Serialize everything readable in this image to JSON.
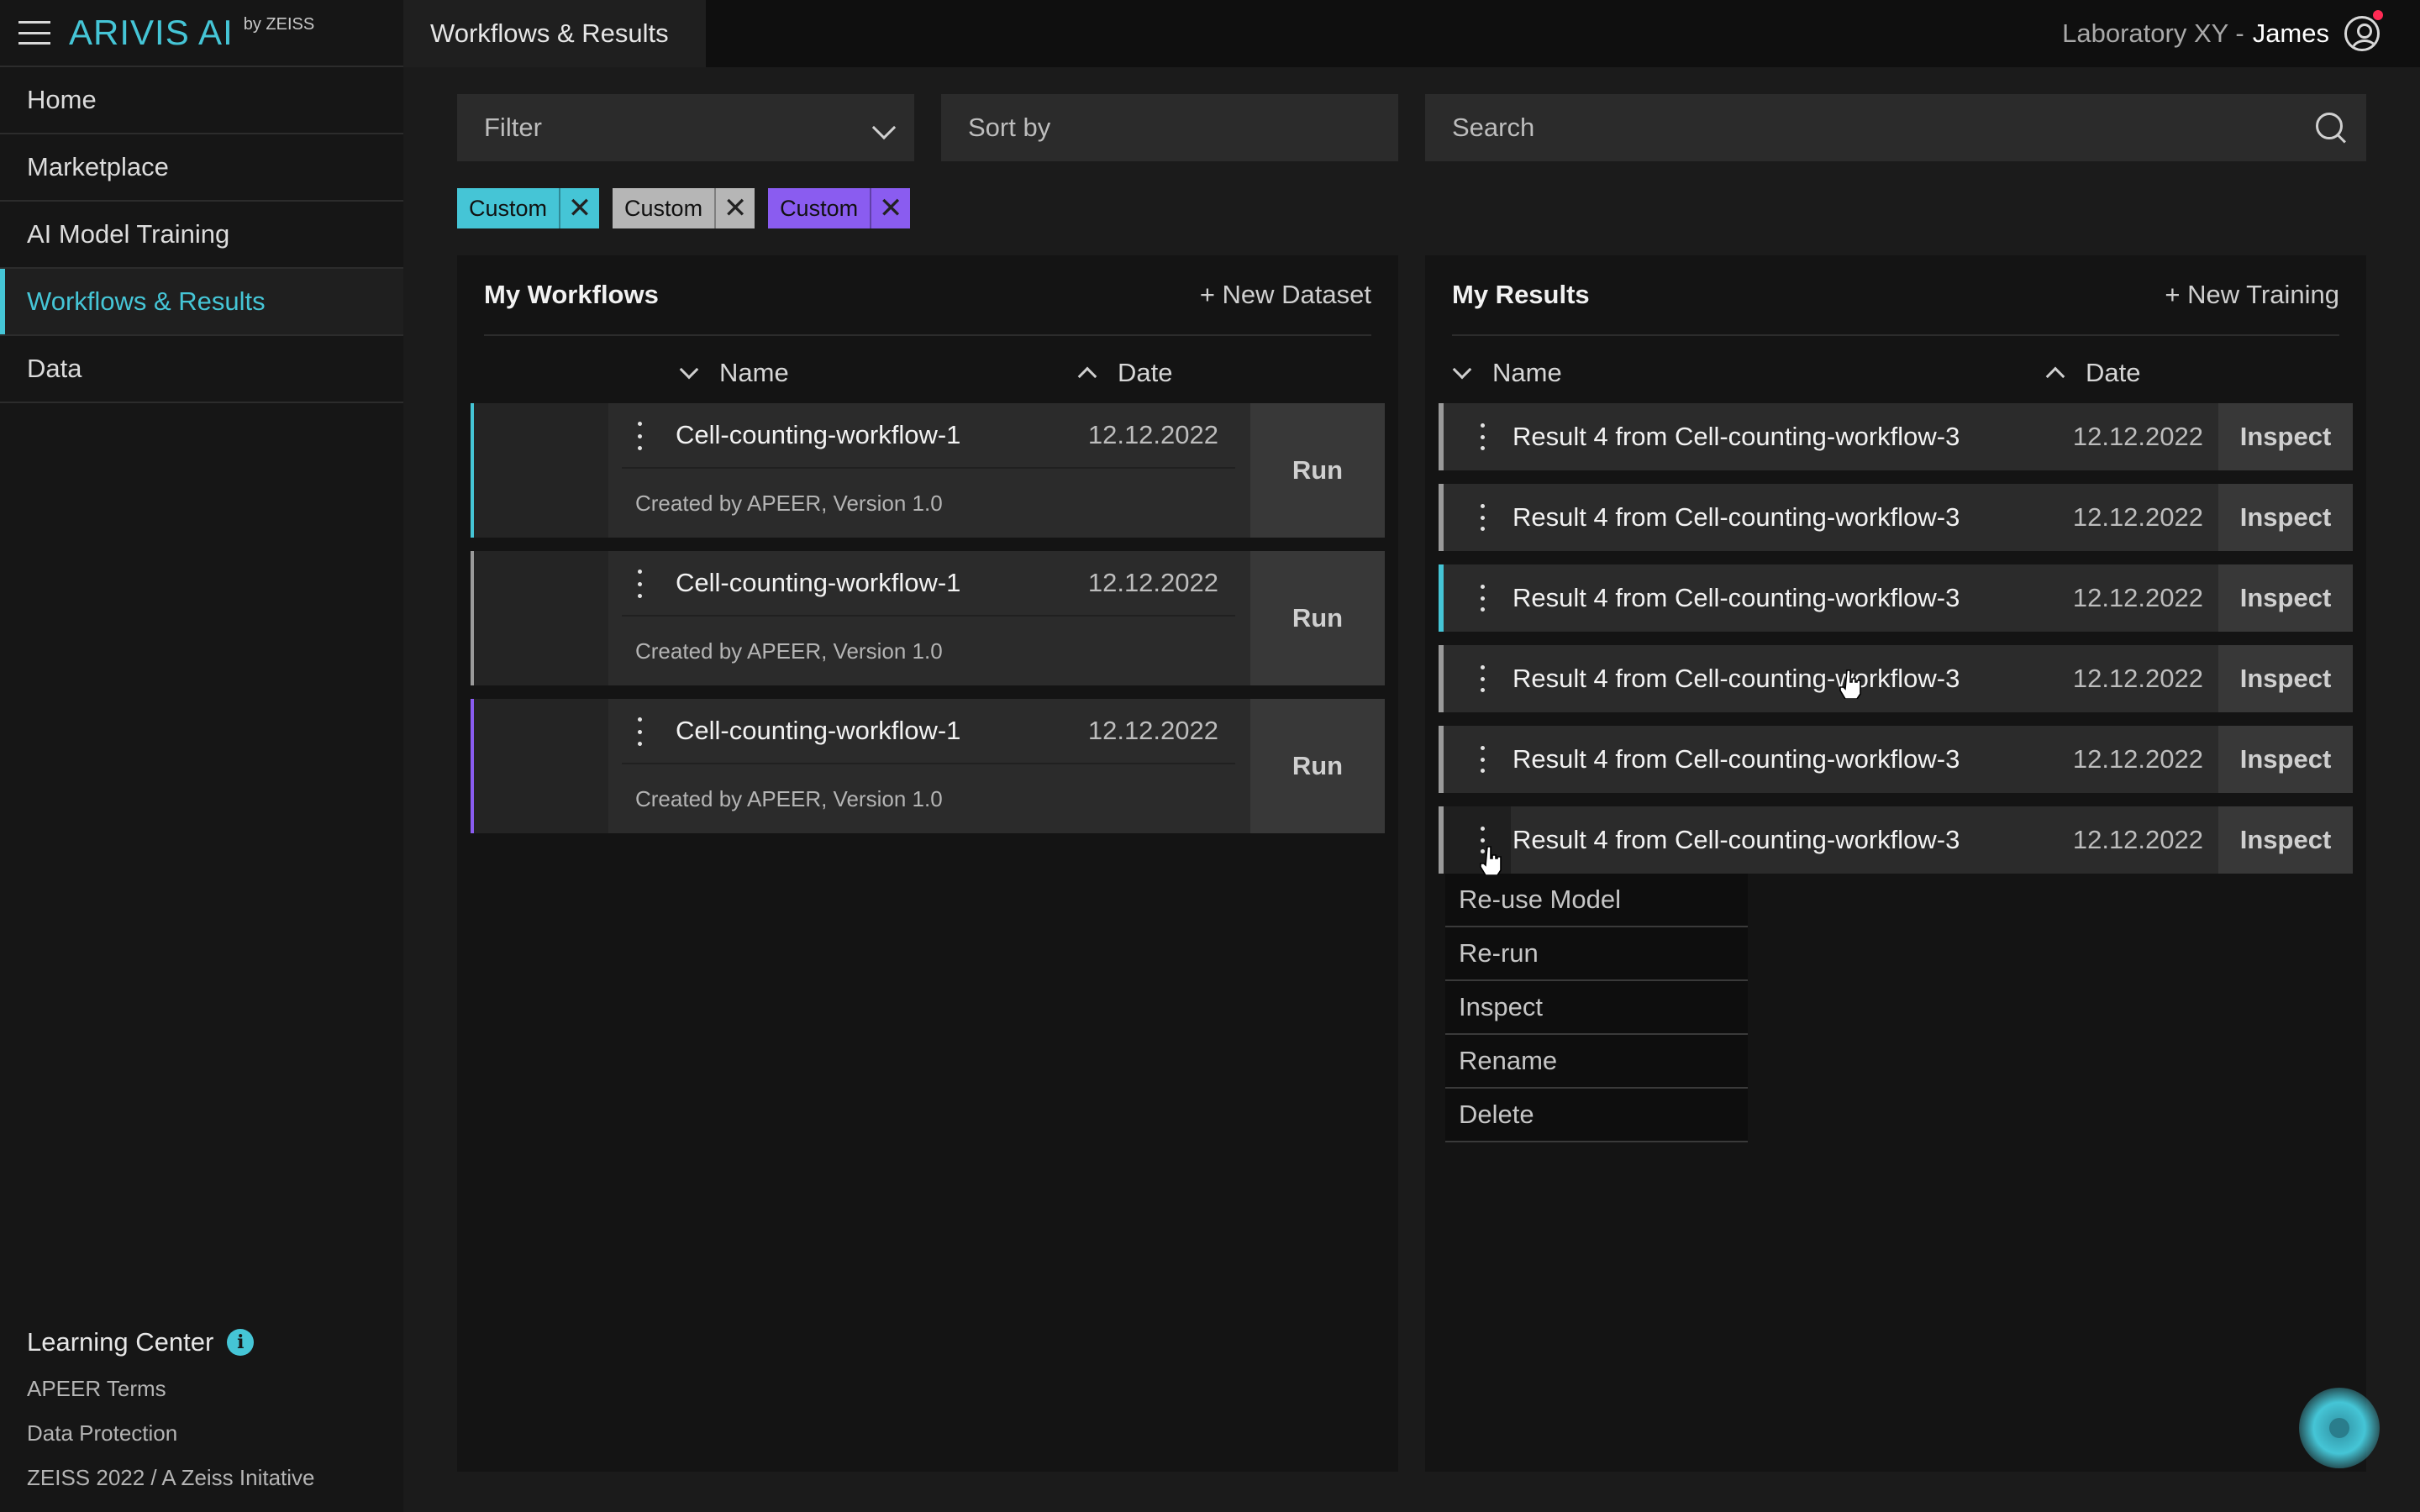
{
  "brand": {
    "name": "ARIVIS AI",
    "by": "by ZEISS"
  },
  "nav": [
    {
      "label": "Home"
    },
    {
      "label": "Marketplace"
    },
    {
      "label": "AI Model Training"
    },
    {
      "label": "Workflows & Results",
      "active": true
    },
    {
      "label": "Data"
    }
  ],
  "learning": {
    "title": "Learning Center",
    "links": [
      "APEER Terms",
      "Data Protection",
      "ZEISS 2022 / A Zeiss Initative"
    ]
  },
  "topbar": {
    "tab": "Workflows & Results",
    "lab": "Laboratory XY -",
    "user": "James"
  },
  "controls": {
    "filter": "Filter",
    "sort": "Sort by",
    "search": "Search"
  },
  "tags": [
    {
      "label": "Custom",
      "color": "#45c5d6"
    },
    {
      "label": "Custom",
      "color": "#b6b6b6"
    },
    {
      "label": "Custom",
      "color": "#8a5cf0"
    }
  ],
  "workflows": {
    "title": "My Workflows",
    "action": "+ New Dataset",
    "col_name": "Name",
    "col_date": "Date",
    "items": [
      {
        "name": "Cell-counting-workflow-1",
        "date": "12.12.2022",
        "meta": "Created by APEER, Version 1.0",
        "run": "Run",
        "accent": "#45c5d6"
      },
      {
        "name": "Cell-counting-workflow-1",
        "date": "12.12.2022",
        "meta": "Created by APEER, Version 1.0",
        "run": "Run",
        "accent": "#9a9a9a"
      },
      {
        "name": "Cell-counting-workflow-1",
        "date": "12.12.2022",
        "meta": "Created by APEER, Version 1.0",
        "run": "Run",
        "accent": "#8a5cf0"
      }
    ]
  },
  "results": {
    "title": "My Results",
    "action": "+ New Training",
    "col_name": "Name",
    "col_date": "Date",
    "items": [
      {
        "name": "Result 4 from Cell-counting-workflow-3",
        "date": "12.12.2022",
        "inspect": "Inspect",
        "accent": "#9a9a9a"
      },
      {
        "name": "Result 4 from Cell-counting-workflow-3",
        "date": "12.12.2022",
        "inspect": "Inspect",
        "accent": "#9a9a9a"
      },
      {
        "name": "Result 4 from Cell-counting-workflow-3",
        "date": "12.12.2022",
        "inspect": "Inspect",
        "accent": "#45c5d6"
      },
      {
        "name": "Result 4 from Cell-counting-workflow-3",
        "date": "12.12.2022",
        "inspect": "Inspect",
        "accent": "#9a9a9a"
      },
      {
        "name": "Result 4 from Cell-counting-workflow-3",
        "date": "12.12.2022",
        "inspect": "Inspect",
        "accent": "#9a9a9a"
      },
      {
        "name": "Result 4 from Cell-counting-workflow-3",
        "date": "12.12.2022",
        "inspect": "Inspect",
        "accent": "#9a9a9a"
      }
    ]
  },
  "context_menu": [
    "Re-use Model",
    "Re-run",
    "Inspect",
    "Rename",
    "Delete"
  ],
  "icons": {
    "menu": "hamburger-icon",
    "user": "user-circle-icon",
    "search": "search-icon",
    "info": "info-icon",
    "more": "kebab-icon",
    "close": "close-icon",
    "help": "help-fab-icon"
  }
}
